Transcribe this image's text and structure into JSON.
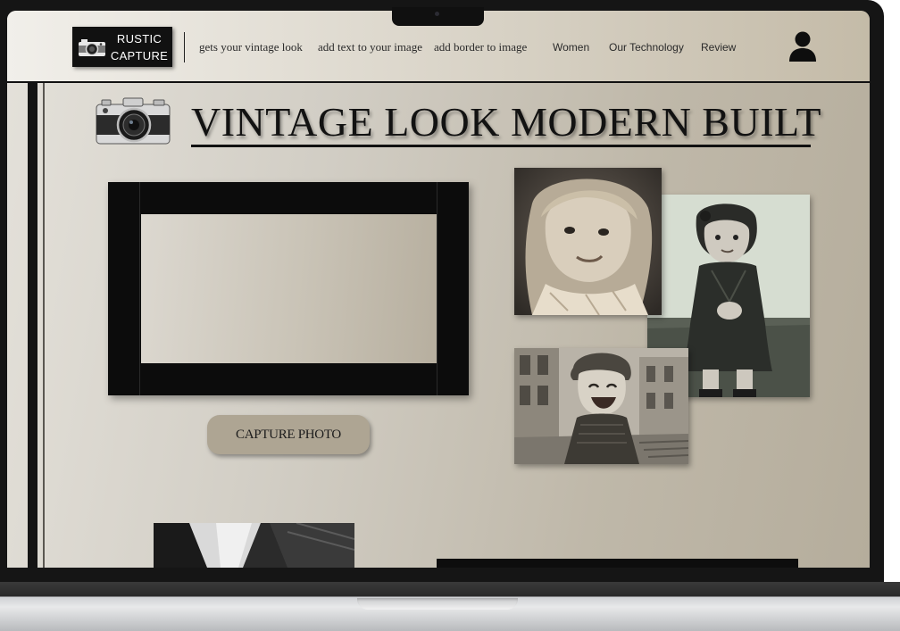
{
  "brand": {
    "line1": "RUSTIC",
    "line2": "CAPTURE",
    "icon": "camera-icon"
  },
  "nav": {
    "links": [
      {
        "label": "gets your vintage look"
      },
      {
        "label": "add text to your image"
      },
      {
        "label": "add border to  image"
      },
      {
        "label": "Women"
      },
      {
        "label": "Our Technology"
      },
      {
        "label": "Review"
      }
    ],
    "account_icon": "user-icon"
  },
  "hero": {
    "title": "VINTAGE LOOK MODERN BUILT",
    "illustration": "vintage-camera-icon"
  },
  "capture": {
    "button_label": "CAPTURE PHOTO"
  },
  "gallery": {
    "photos": [
      {
        "subject": "vintage-girl-portrait"
      },
      {
        "subject": "toddler-girl-standing"
      },
      {
        "subject": "laughing-child-street"
      }
    ]
  },
  "colors": {
    "ink": "#111111",
    "button": "#aea593",
    "background_light": "#e4e1da",
    "background_dark": "#b5ad9c"
  }
}
